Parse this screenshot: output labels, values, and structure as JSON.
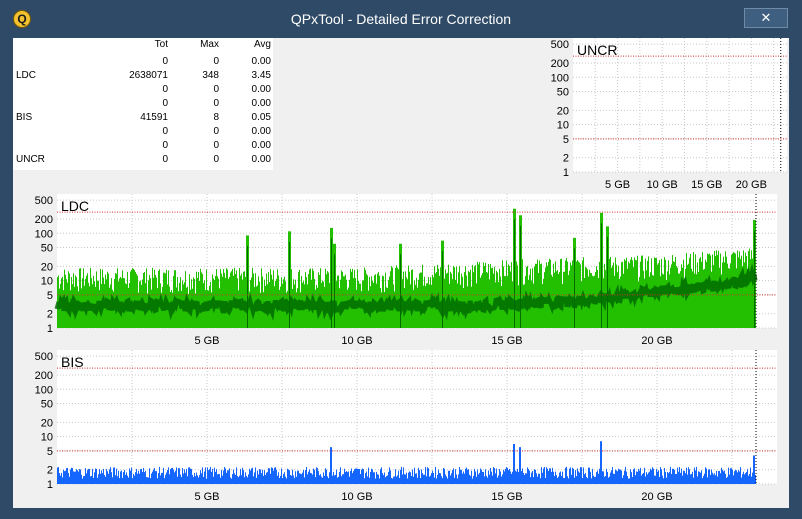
{
  "window": {
    "title": "QPxTool - Detailed Error Correction",
    "close_symbol": "✕",
    "app_icon_letter": "Q"
  },
  "stats": {
    "headers": {
      "tot": "Tot",
      "max": "Max",
      "avg": "Avg"
    },
    "rows": [
      {
        "label": "",
        "tot": "0",
        "max": "0",
        "avg": "0.00"
      },
      {
        "label": "LDC",
        "tot": "2638071",
        "max": "348",
        "avg": "3.45"
      },
      {
        "label": "",
        "tot": "0",
        "max": "0",
        "avg": "0.00"
      },
      {
        "label": "",
        "tot": "0",
        "max": "0",
        "avg": "0.00"
      },
      {
        "label": "BIS",
        "tot": "41591",
        "max": "8",
        "avg": "0.05"
      },
      {
        "label": "",
        "tot": "0",
        "max": "0",
        "avg": "0.00"
      },
      {
        "label": "",
        "tot": "0",
        "max": "0",
        "avg": "0.00"
      },
      {
        "label": "UNCR",
        "tot": "0",
        "max": "0",
        "avg": "0.00"
      }
    ]
  },
  "chart_data": [
    {
      "type": "bar",
      "title": "UNCR",
      "scale": "log",
      "ylim": [
        1,
        500
      ],
      "yticks": [
        "500",
        "200",
        "100",
        "50",
        "20",
        "10",
        "5",
        "2",
        "1"
      ],
      "xlim": [
        0,
        24
      ],
      "xticks": [
        "5 GB",
        "10 GB",
        "15 GB",
        "20 GB"
      ],
      "xtick_values": [
        5,
        10,
        15,
        20
      ],
      "threshold_lines": [
        5,
        280
      ],
      "end_marker": 23.3,
      "color": "#00b000",
      "spikes": []
    },
    {
      "type": "bar",
      "title": "LDC",
      "scale": "log",
      "ylim": [
        1,
        500
      ],
      "yticks": [
        "500",
        "200",
        "100",
        "50",
        "20",
        "10",
        "5",
        "2",
        "1"
      ],
      "xlim": [
        0,
        24
      ],
      "xticks": [
        "5 GB",
        "10 GB",
        "15 GB",
        "20 GB"
      ],
      "xtick_values": [
        5,
        10,
        15,
        20
      ],
      "threshold_lines": [
        5,
        280
      ],
      "end_marker": 23.3,
      "color": "#22c000",
      "dark_color": "#006b00",
      "baseline_max": [
        [
          0,
          15
        ],
        [
          10,
          15
        ],
        [
          15,
          22
        ],
        [
          20,
          28
        ],
        [
          23,
          40
        ]
      ],
      "baseline_avg": [
        [
          0,
          3
        ],
        [
          14,
          3
        ],
        [
          18,
          4
        ],
        [
          22,
          8
        ],
        [
          23.3,
          12
        ]
      ],
      "spikes": [
        [
          9.1,
          130
        ],
        [
          9.2,
          60
        ],
        [
          15.2,
          330
        ],
        [
          15.4,
          240
        ],
        [
          18.1,
          270
        ],
        [
          18.3,
          140
        ],
        [
          17.2,
          80
        ],
        [
          6.3,
          90
        ],
        [
          7.7,
          110
        ],
        [
          12.8,
          70
        ],
        [
          23.2,
          190
        ],
        [
          11.4,
          60
        ]
      ]
    },
    {
      "type": "bar",
      "title": "BIS",
      "scale": "log",
      "ylim": [
        1,
        500
      ],
      "yticks": [
        "500",
        "200",
        "100",
        "50",
        "20",
        "10",
        "5",
        "2",
        "1"
      ],
      "xlim": [
        0,
        24
      ],
      "xticks": [
        "5 GB",
        "10 GB",
        "15 GB",
        "20 GB"
      ],
      "xtick_values": [
        5,
        10,
        15,
        20
      ],
      "threshold_lines": [
        5,
        280
      ],
      "end_marker": 23.3,
      "color": "#1565ff",
      "baseline": 2,
      "spikes": [
        [
          9.1,
          6
        ],
        [
          15.2,
          7
        ],
        [
          15.4,
          6
        ],
        [
          18.1,
          8
        ],
        [
          23.2,
          4
        ]
      ]
    }
  ]
}
